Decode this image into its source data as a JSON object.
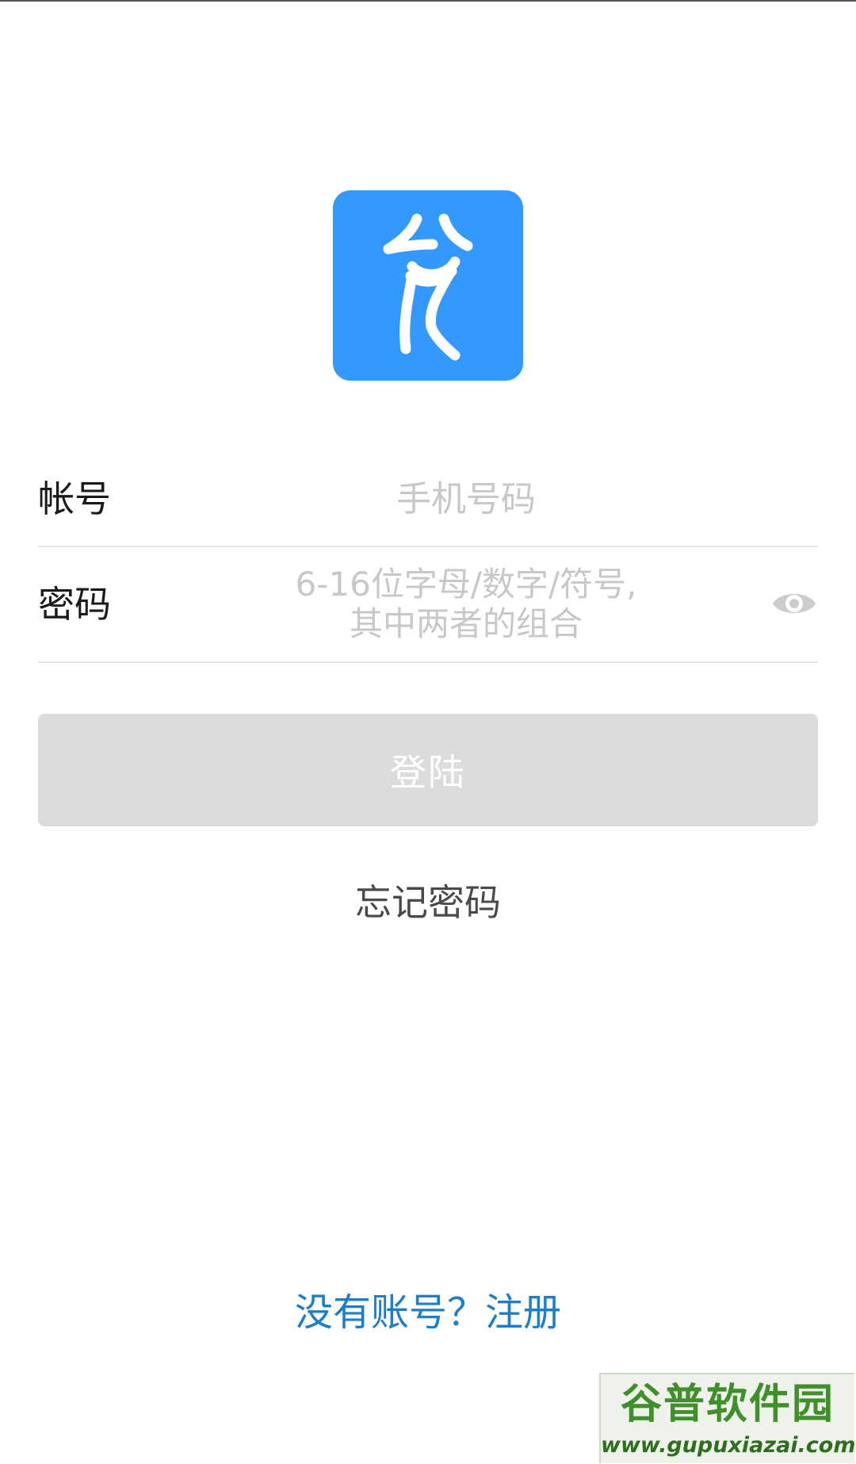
{
  "app": {
    "logo_icon": "calligraphy-logo-icon",
    "brand_color": "#3399FF"
  },
  "form": {
    "account": {
      "label": "帐号",
      "placeholder": "手机号码",
      "value": ""
    },
    "password": {
      "label": "密码",
      "placeholder_line1": "6-16位字母/数字/符号,",
      "placeholder_line2": "其中两者的组合",
      "value": "",
      "toggle_icon": "eye-icon"
    },
    "login_button": {
      "label": "登陆",
      "state": "disabled",
      "color": "#dcdcdc"
    },
    "forgot_password": "忘记密码"
  },
  "footer": {
    "register_link": "没有账号？注册",
    "link_color": "#1E7FC8"
  },
  "watermark": {
    "title": "谷普软件园",
    "url": "www.gupuxiazai.com"
  }
}
